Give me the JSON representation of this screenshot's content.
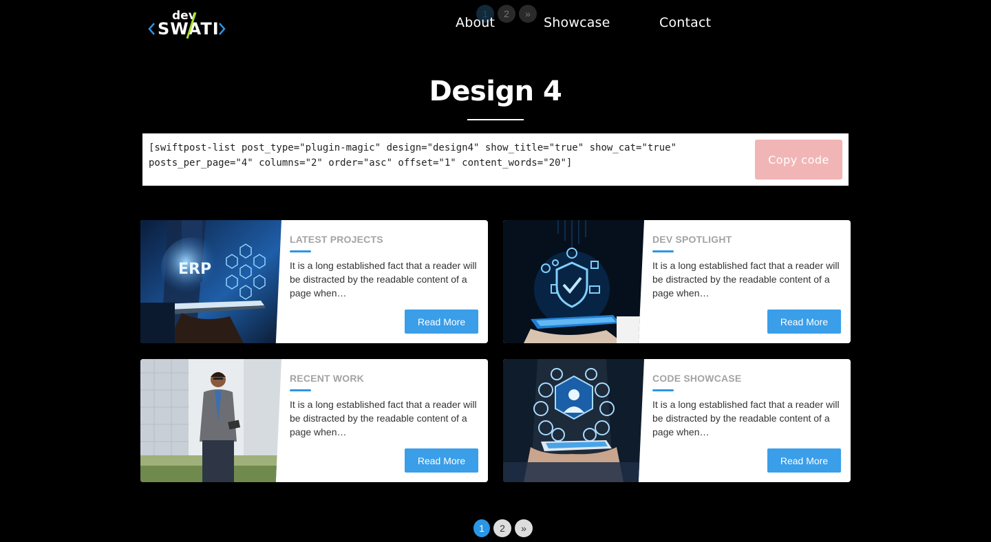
{
  "brand": {
    "prefix": "dev",
    "name": "SWATI"
  },
  "nav": {
    "about": "About",
    "showcase": "Showcase",
    "contact": "Contact"
  },
  "ghost_pager": [
    "1",
    "2",
    "»"
  ],
  "page_title": "Design 4",
  "shortcode": {
    "line1": "[swiftpost-list post_type=\"plugin-magic\" design=\"design4\" show_title=\"true\" show_cat=\"true\"",
    "line2": "posts_per_page=\"4\" columns=\"2\" order=\"asc\" offset=\"1\" content_words=\"20\"]",
    "copy_label": "Copy code"
  },
  "cards": [
    {
      "category": "LATEST PROJECTS",
      "excerpt": "It is a long established fact that a reader will be distracted by the readable content of a page when…",
      "button": "Read More",
      "image": "erp-tablet-photo"
    },
    {
      "category": "DEV SPOTLIGHT",
      "excerpt": "It is a long established fact that a reader will be distracted by the readable content of a page when…",
      "button": "Read More",
      "image": "security-shield-tablet-photo"
    },
    {
      "category": "RECENT WORK",
      "excerpt": "It is a long established fact that a reader will be distracted by the readable content of a page when…",
      "button": "Read More",
      "image": "businessman-photo"
    },
    {
      "category": "CODE SHOWCASE",
      "excerpt": "It is a long established fact that a reader will be distracted by the readable content of a page when…",
      "button": "Read More",
      "image": "network-icons-tablet-photo"
    }
  ],
  "pagination": {
    "pages": [
      "1",
      "2"
    ],
    "next": "»",
    "current": "1"
  },
  "colors": {
    "accent": "#2b95e6",
    "button": "#3a9ee9",
    "copy_button": "#f2b5b5",
    "background": "#000000"
  }
}
